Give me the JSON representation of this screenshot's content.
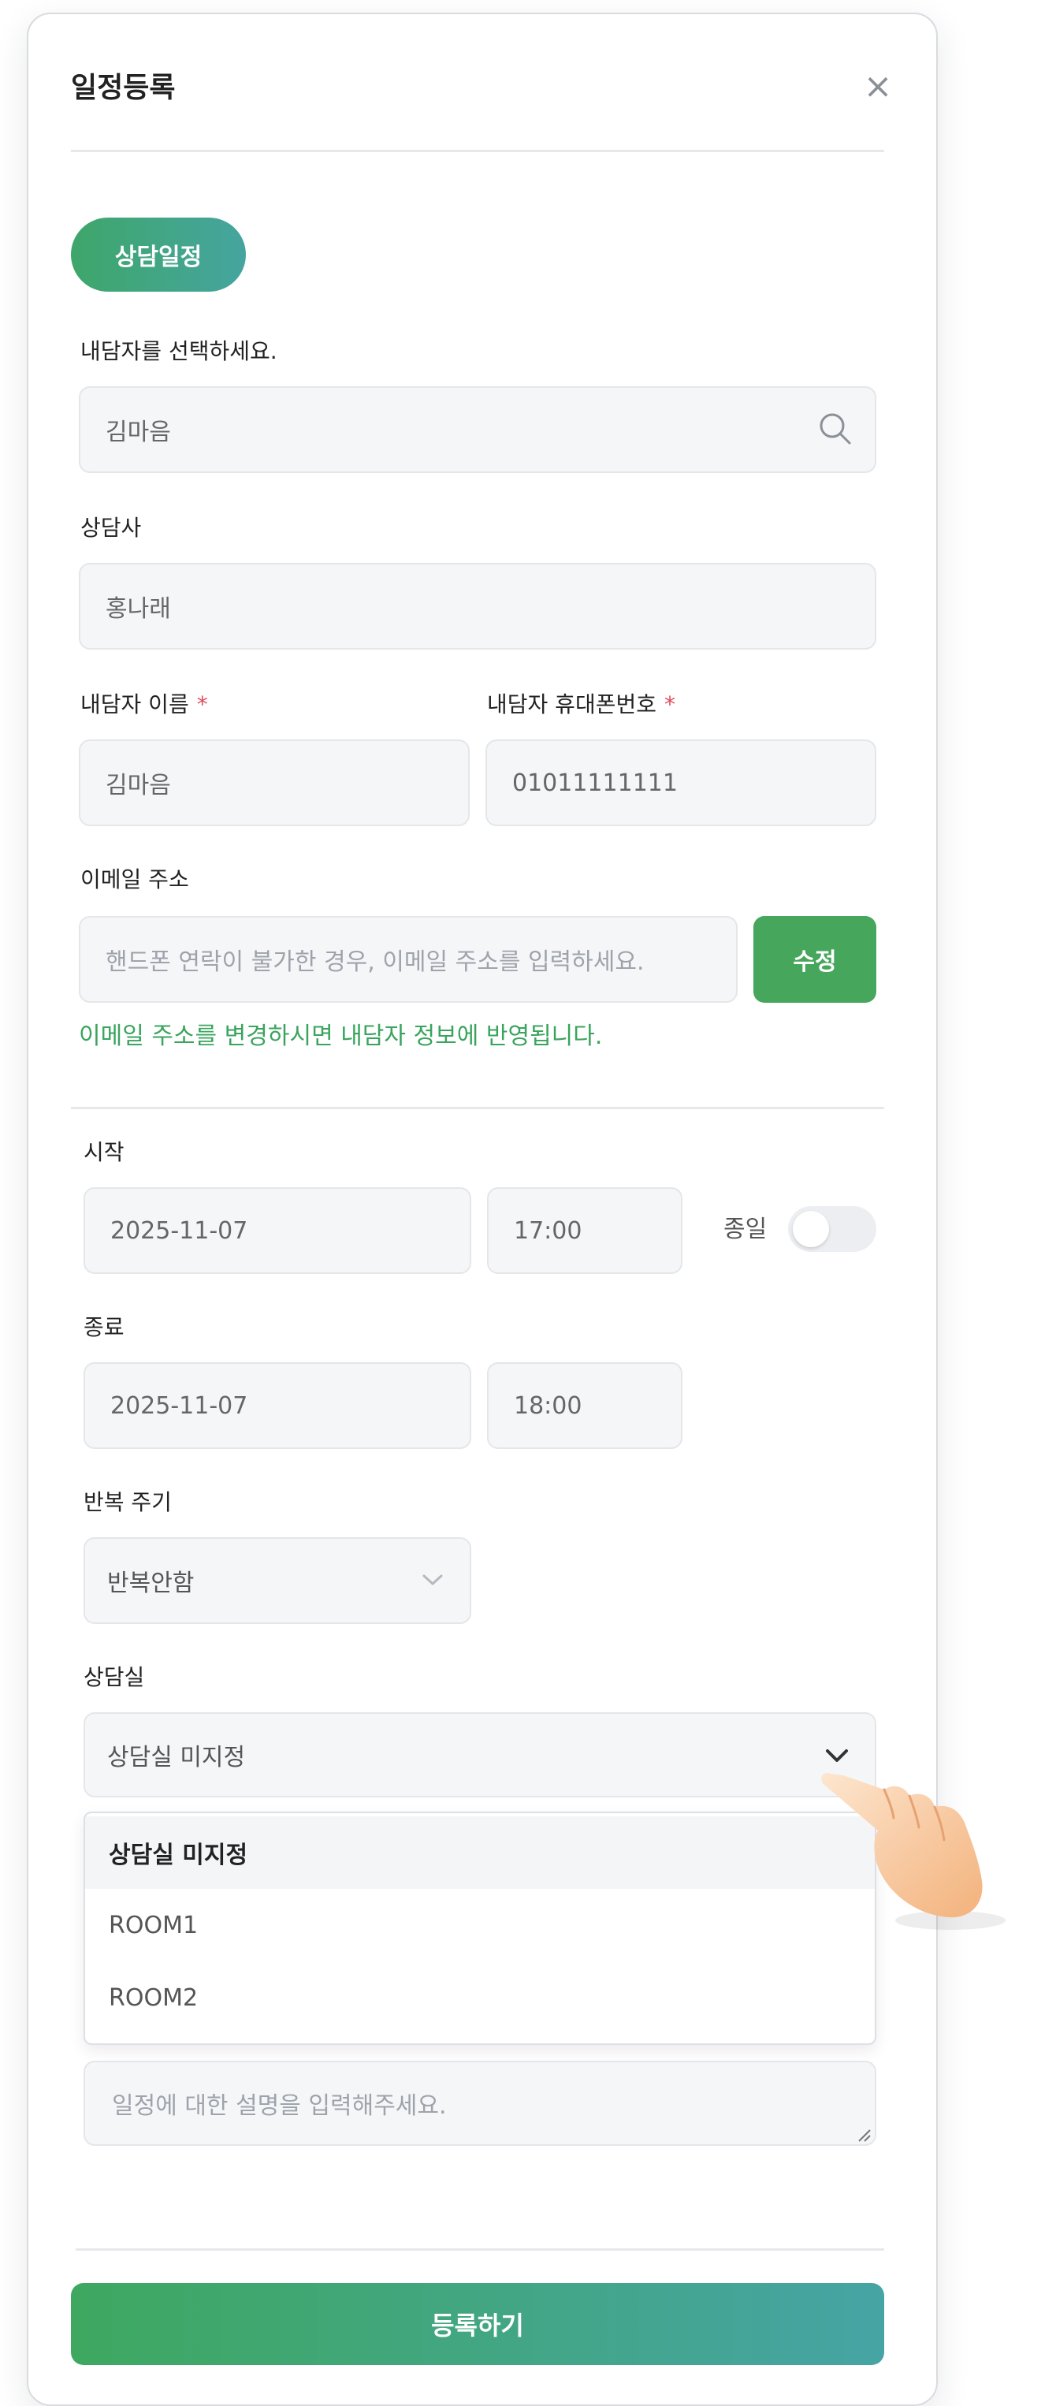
{
  "modal": {
    "title": "일정등록"
  },
  "type_pill": "상담일정",
  "client": {
    "label": "내담자를 선택하세요.",
    "value": "김마음"
  },
  "counselor": {
    "label": "상담사",
    "value": "홍나래"
  },
  "client_name": {
    "label": "내담자 이름",
    "required": "*",
    "value": "김마음"
  },
  "client_phone": {
    "label": "내담자 휴대폰번호",
    "required": "*",
    "value": "01011111111"
  },
  "email": {
    "label": "이메일 주소",
    "placeholder": "핸드폰 연락이 불가한 경우, 이메일 주소를 입력하세요.",
    "edit_button": "수정",
    "note": "이메일 주소를 변경하시면 내담자 정보에 반영됩니다."
  },
  "start": {
    "label": "시작",
    "date": "2025-11-07",
    "time": "17:00",
    "all_day_label": "종일",
    "all_day": false
  },
  "end": {
    "label": "종료",
    "date": "2025-11-07",
    "time": "18:00"
  },
  "repeat": {
    "label": "반복 주기",
    "value": "반복안함"
  },
  "room": {
    "label": "상담실",
    "value": "상담실 미지정",
    "options": [
      "상담실 미지정",
      "ROOM1",
      "ROOM2"
    ]
  },
  "description": {
    "placeholder": "일정에 대한 설명을 입력해주세요."
  },
  "submit_button": "등록하기",
  "colors": {
    "accent": "#46a65c",
    "gradient_end": "#45a59f",
    "required": "#e24b5b"
  },
  "icons": [
    "close-icon",
    "search-icon",
    "chevron-down-icon",
    "hand-pointer-icon"
  ]
}
